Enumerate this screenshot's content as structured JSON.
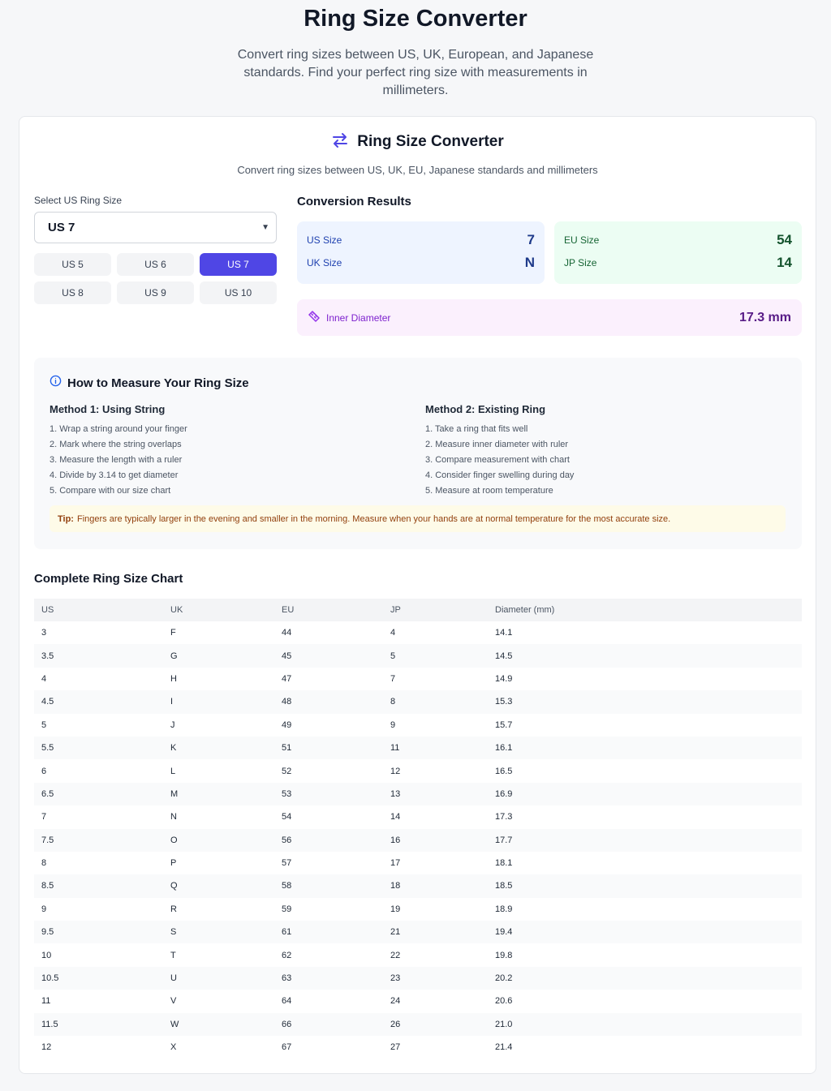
{
  "header": {
    "title": "Ring Size Converter",
    "subtitle": "Convert ring sizes between US, UK, European, and Japanese standards. Find your perfect ring size with measurements in millimeters."
  },
  "converter": {
    "title": "Ring Size Converter",
    "icon": "arrows-exchange-icon",
    "subtitle": "Convert ring sizes between US, UK, EU, Japanese standards and millimeters",
    "select_label": "Select US Ring Size",
    "selected": "US 7",
    "quick_sizes": [
      "US 5",
      "US 6",
      "US 7",
      "US 8",
      "US 9",
      "US 10"
    ],
    "active_quick": "US 7",
    "accent_color": "#4f46e5"
  },
  "results": {
    "title": "Conversion Results",
    "us_label": "US Size",
    "us_value": "7",
    "uk_label": "UK Size",
    "uk_value": "N",
    "eu_label": "EU Size",
    "eu_value": "54",
    "jp_label": "JP Size",
    "jp_value": "14",
    "diameter_label": "Inner Diameter",
    "diameter_value": "17.3 mm"
  },
  "measure": {
    "title": "How to Measure Your Ring Size",
    "method1": {
      "title": "Method 1: Using String",
      "steps": [
        "1. Wrap a string around your finger",
        "2. Mark where the string overlaps",
        "3. Measure the length with a ruler",
        "4. Divide by 3.14 to get diameter",
        "5. Compare with our size chart"
      ]
    },
    "method2": {
      "title": "Method 2: Existing Ring",
      "steps": [
        "1. Take a ring that fits well",
        "2. Measure inner diameter with ruler",
        "3. Compare measurement with chart",
        "4. Consider finger swelling during day",
        "5. Measure at room temperature"
      ]
    },
    "tip_label": "Tip:",
    "tip_text": "Fingers are typically larger in the evening and smaller in the morning. Measure when your hands are at normal temperature for the most accurate size."
  },
  "chart": {
    "title": "Complete Ring Size Chart",
    "headers": [
      "US",
      "UK",
      "EU",
      "JP",
      "Diameter (mm)"
    ],
    "rows": [
      [
        "3",
        "F",
        "44",
        "4",
        "14.1"
      ],
      [
        "3.5",
        "G",
        "45",
        "5",
        "14.5"
      ],
      [
        "4",
        "H",
        "47",
        "7",
        "14.9"
      ],
      [
        "4.5",
        "I",
        "48",
        "8",
        "15.3"
      ],
      [
        "5",
        "J",
        "49",
        "9",
        "15.7"
      ],
      [
        "5.5",
        "K",
        "51",
        "11",
        "16.1"
      ],
      [
        "6",
        "L",
        "52",
        "12",
        "16.5"
      ],
      [
        "6.5",
        "M",
        "53",
        "13",
        "16.9"
      ],
      [
        "7",
        "N",
        "54",
        "14",
        "17.3"
      ],
      [
        "7.5",
        "O",
        "56",
        "16",
        "17.7"
      ],
      [
        "8",
        "P",
        "57",
        "17",
        "18.1"
      ],
      [
        "8.5",
        "Q",
        "58",
        "18",
        "18.5"
      ],
      [
        "9",
        "R",
        "59",
        "19",
        "18.9"
      ],
      [
        "9.5",
        "S",
        "61",
        "21",
        "19.4"
      ],
      [
        "10",
        "T",
        "62",
        "22",
        "19.8"
      ],
      [
        "10.5",
        "U",
        "63",
        "23",
        "20.2"
      ],
      [
        "11",
        "V",
        "64",
        "24",
        "20.6"
      ],
      [
        "11.5",
        "W",
        "66",
        "26",
        "21.0"
      ],
      [
        "12",
        "X",
        "67",
        "27",
        "21.4"
      ]
    ]
  }
}
